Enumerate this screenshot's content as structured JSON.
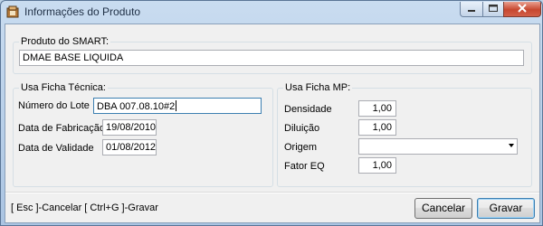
{
  "window": {
    "title": "Informações do Produto",
    "icon": "product-box-icon"
  },
  "produto": {
    "group_label": "Produto do SMART:",
    "value": "DMAE BASE LIQUIDA"
  },
  "ficha_tecnica": {
    "group_label": "Usa Ficha Técnica:",
    "numero_lote_label": "Número do Lote",
    "numero_lote_value": "DBA 007.08.10#2",
    "data_fabricacao_label": "Data de Fabricação",
    "data_fabricacao_value": "19/08/2010",
    "data_validade_label": "Data de Validade",
    "data_validade_value": "01/08/2012"
  },
  "ficha_mp": {
    "group_label": "Usa Ficha MP:",
    "densidade_label": "Densidade",
    "densidade_value": "1,00",
    "diluicao_label": "Diluição",
    "diluicao_value": "1,00",
    "origem_label": "Origem",
    "origem_value": "",
    "fator_eq_label": "Fator EQ",
    "fator_eq_value": "1,00"
  },
  "footer": {
    "shortcuts": "[ Esc ]-Cancelar   [ Ctrl+G ]-Gravar",
    "cancel_label": "Cancelar",
    "save_label": "Gravar"
  },
  "colors": {
    "titlebar": "#c9dcf0",
    "close_button": "#c7472f",
    "client_background": "#f0f0f0"
  }
}
